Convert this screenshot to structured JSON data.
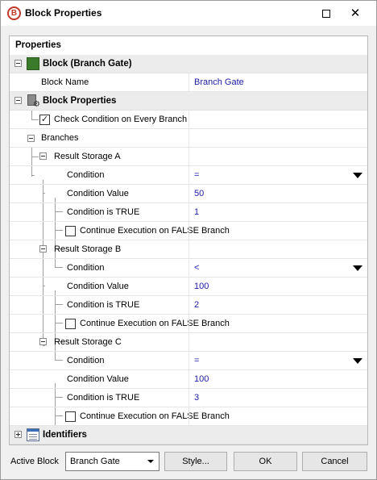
{
  "window": {
    "title": "Block Properties",
    "app_icon_letter": "B"
  },
  "panel": {
    "header": "Properties",
    "block_category": "Block (Branch Gate)",
    "block_name_label": "Block Name",
    "block_name_value": "Branch Gate",
    "block_props_category": "Block Properties",
    "check_condition_label": "Check Condition on Every Branch",
    "check_condition_checked": true,
    "branches_label": "Branches",
    "branches": [
      {
        "name": "Result Storage A",
        "condition_label": "Condition",
        "condition_value": "=",
        "condition_value_label": "Condition Value",
        "condition_value_value": "50",
        "is_true_label": "Condition is TRUE",
        "is_true_value": "1",
        "continue_label": "Continue Execution on FALSE Branch",
        "continue_checked": false
      },
      {
        "name": "Result Storage B",
        "condition_label": "Condition",
        "condition_value": "<",
        "condition_value_label": "Condition Value",
        "condition_value_value": "100",
        "is_true_label": "Condition is TRUE",
        "is_true_value": "2",
        "continue_label": "Continue Execution on FALSE Branch",
        "continue_checked": false
      },
      {
        "name": "Result Storage C",
        "condition_label": "Condition",
        "condition_value": "=",
        "condition_value_label": "Condition Value",
        "condition_value_value": "100",
        "is_true_label": "Condition is TRUE",
        "is_true_value": "3",
        "continue_label": "Continue Execution on FALSE Branch",
        "continue_checked": false
      }
    ],
    "identifiers_category": "Identifiers"
  },
  "bottom": {
    "active_block_label": "Active Block",
    "active_block_value": "Branch Gate",
    "style_button": "Style...",
    "ok_button": "OK",
    "cancel_button": "Cancel"
  },
  "colors": {
    "value_text": "#1a1aa6",
    "category_bg": "#ececec",
    "block_icon": "#3a7a2a"
  },
  "icons": [
    "app-logo-icon",
    "maximize-icon",
    "close-icon",
    "block-icon",
    "properties-gear-icon",
    "identifiers-icon",
    "checkbox-icon",
    "dropdown-arrow-icon"
  ]
}
